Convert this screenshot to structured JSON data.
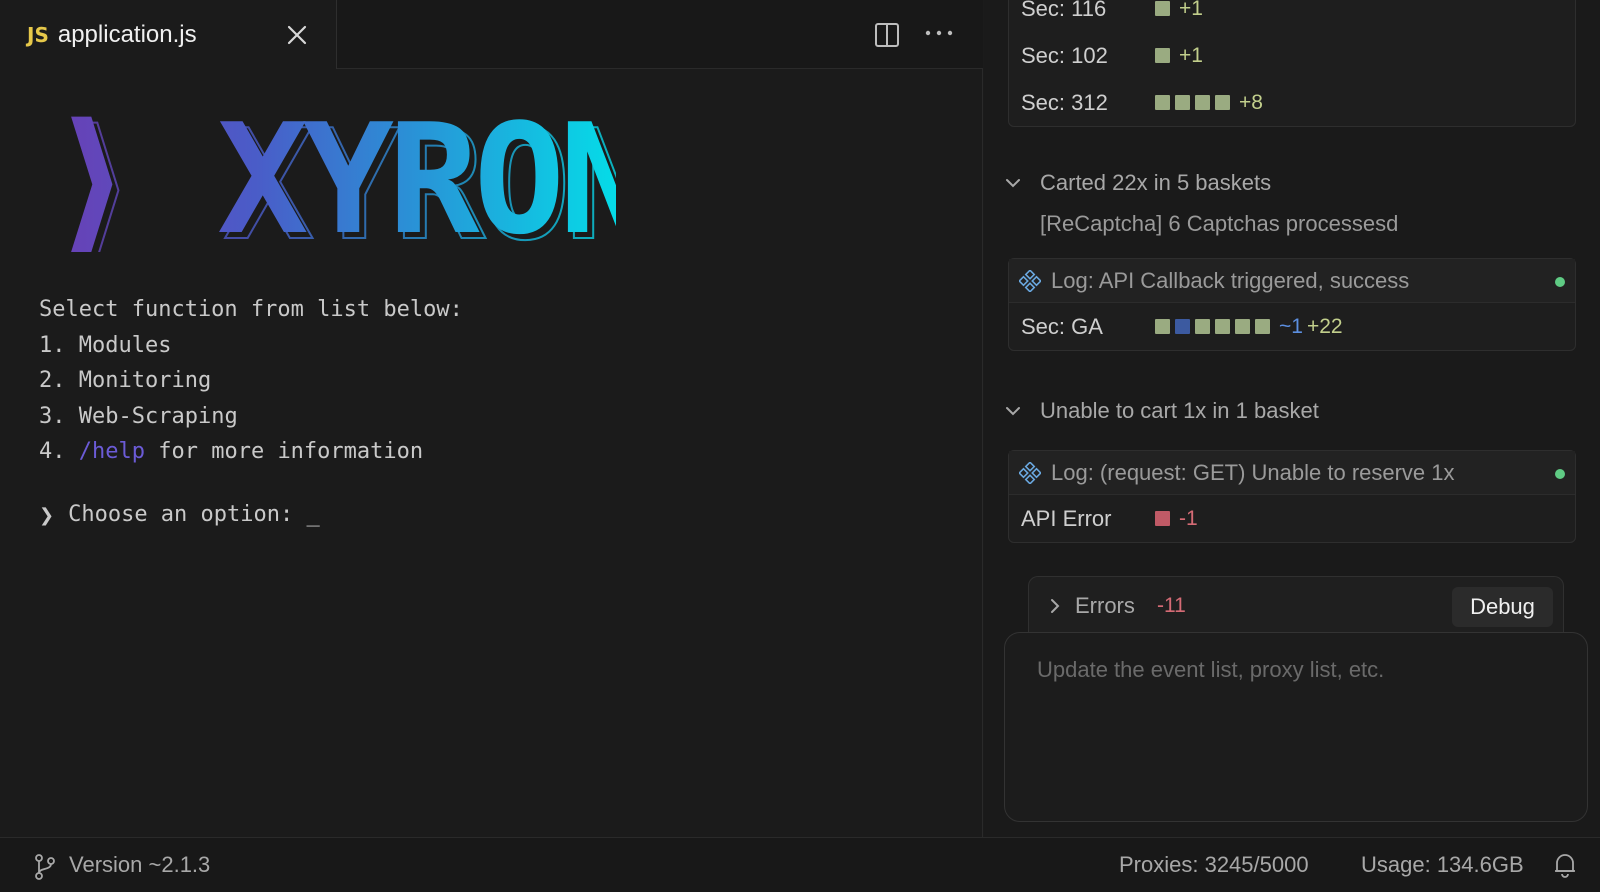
{
  "tab": {
    "lang_badge": "JS",
    "filename": "application.js"
  },
  "logo": {
    "text": "⟩ XYRON"
  },
  "terminal": {
    "intro": "Select function from list below:",
    "options": [
      {
        "num": "1.",
        "label": "Modules"
      },
      {
        "num": "2.",
        "label": "Monitoring"
      },
      {
        "num": "3.",
        "label": "Web-Scraping"
      }
    ],
    "help": {
      "num": "4.",
      "cmd": "/help",
      "rest": "for more information"
    },
    "prompt": "Choose an option: _"
  },
  "panel": {
    "top_card": {
      "rows": [
        {
          "label": "Sec: 116",
          "squares": 1,
          "delta": "+1"
        },
        {
          "label": "Sec: 102",
          "squares": 1,
          "delta": "+1"
        },
        {
          "label": "Sec: 312",
          "squares": 4,
          "delta": "+8"
        }
      ]
    },
    "group1": {
      "title": "Carted 22x in 5 baskets",
      "sub": "[ReCaptcha] 6 Captchas processesd",
      "log": "Log: API Callback triggered, success",
      "row": {
        "label": "Sec: GA",
        "tilde": "~1",
        "delta": "+22"
      }
    },
    "group2": {
      "title": "Unable to cart 1x in 1 basket",
      "log": "Log: (request: GET) Unable to reserve 1x",
      "row": {
        "label": "API Error",
        "delta": "-1"
      }
    },
    "errors": {
      "label": "Errors",
      "count": "-11",
      "debug_label": "Debug"
    },
    "input": {
      "placeholder": "Update the event list, proxy list, etc.",
      "value": ""
    }
  },
  "status": {
    "version": "Version ~2.1.3",
    "proxies": "Proxies: 3245/5000",
    "usage": "Usage: 134.6GB"
  },
  "colors": {
    "accent_purple": "#6b5bd6",
    "logo_cyan": "#00e0e8",
    "success": "#5fcb84",
    "error": "#d56b75"
  }
}
